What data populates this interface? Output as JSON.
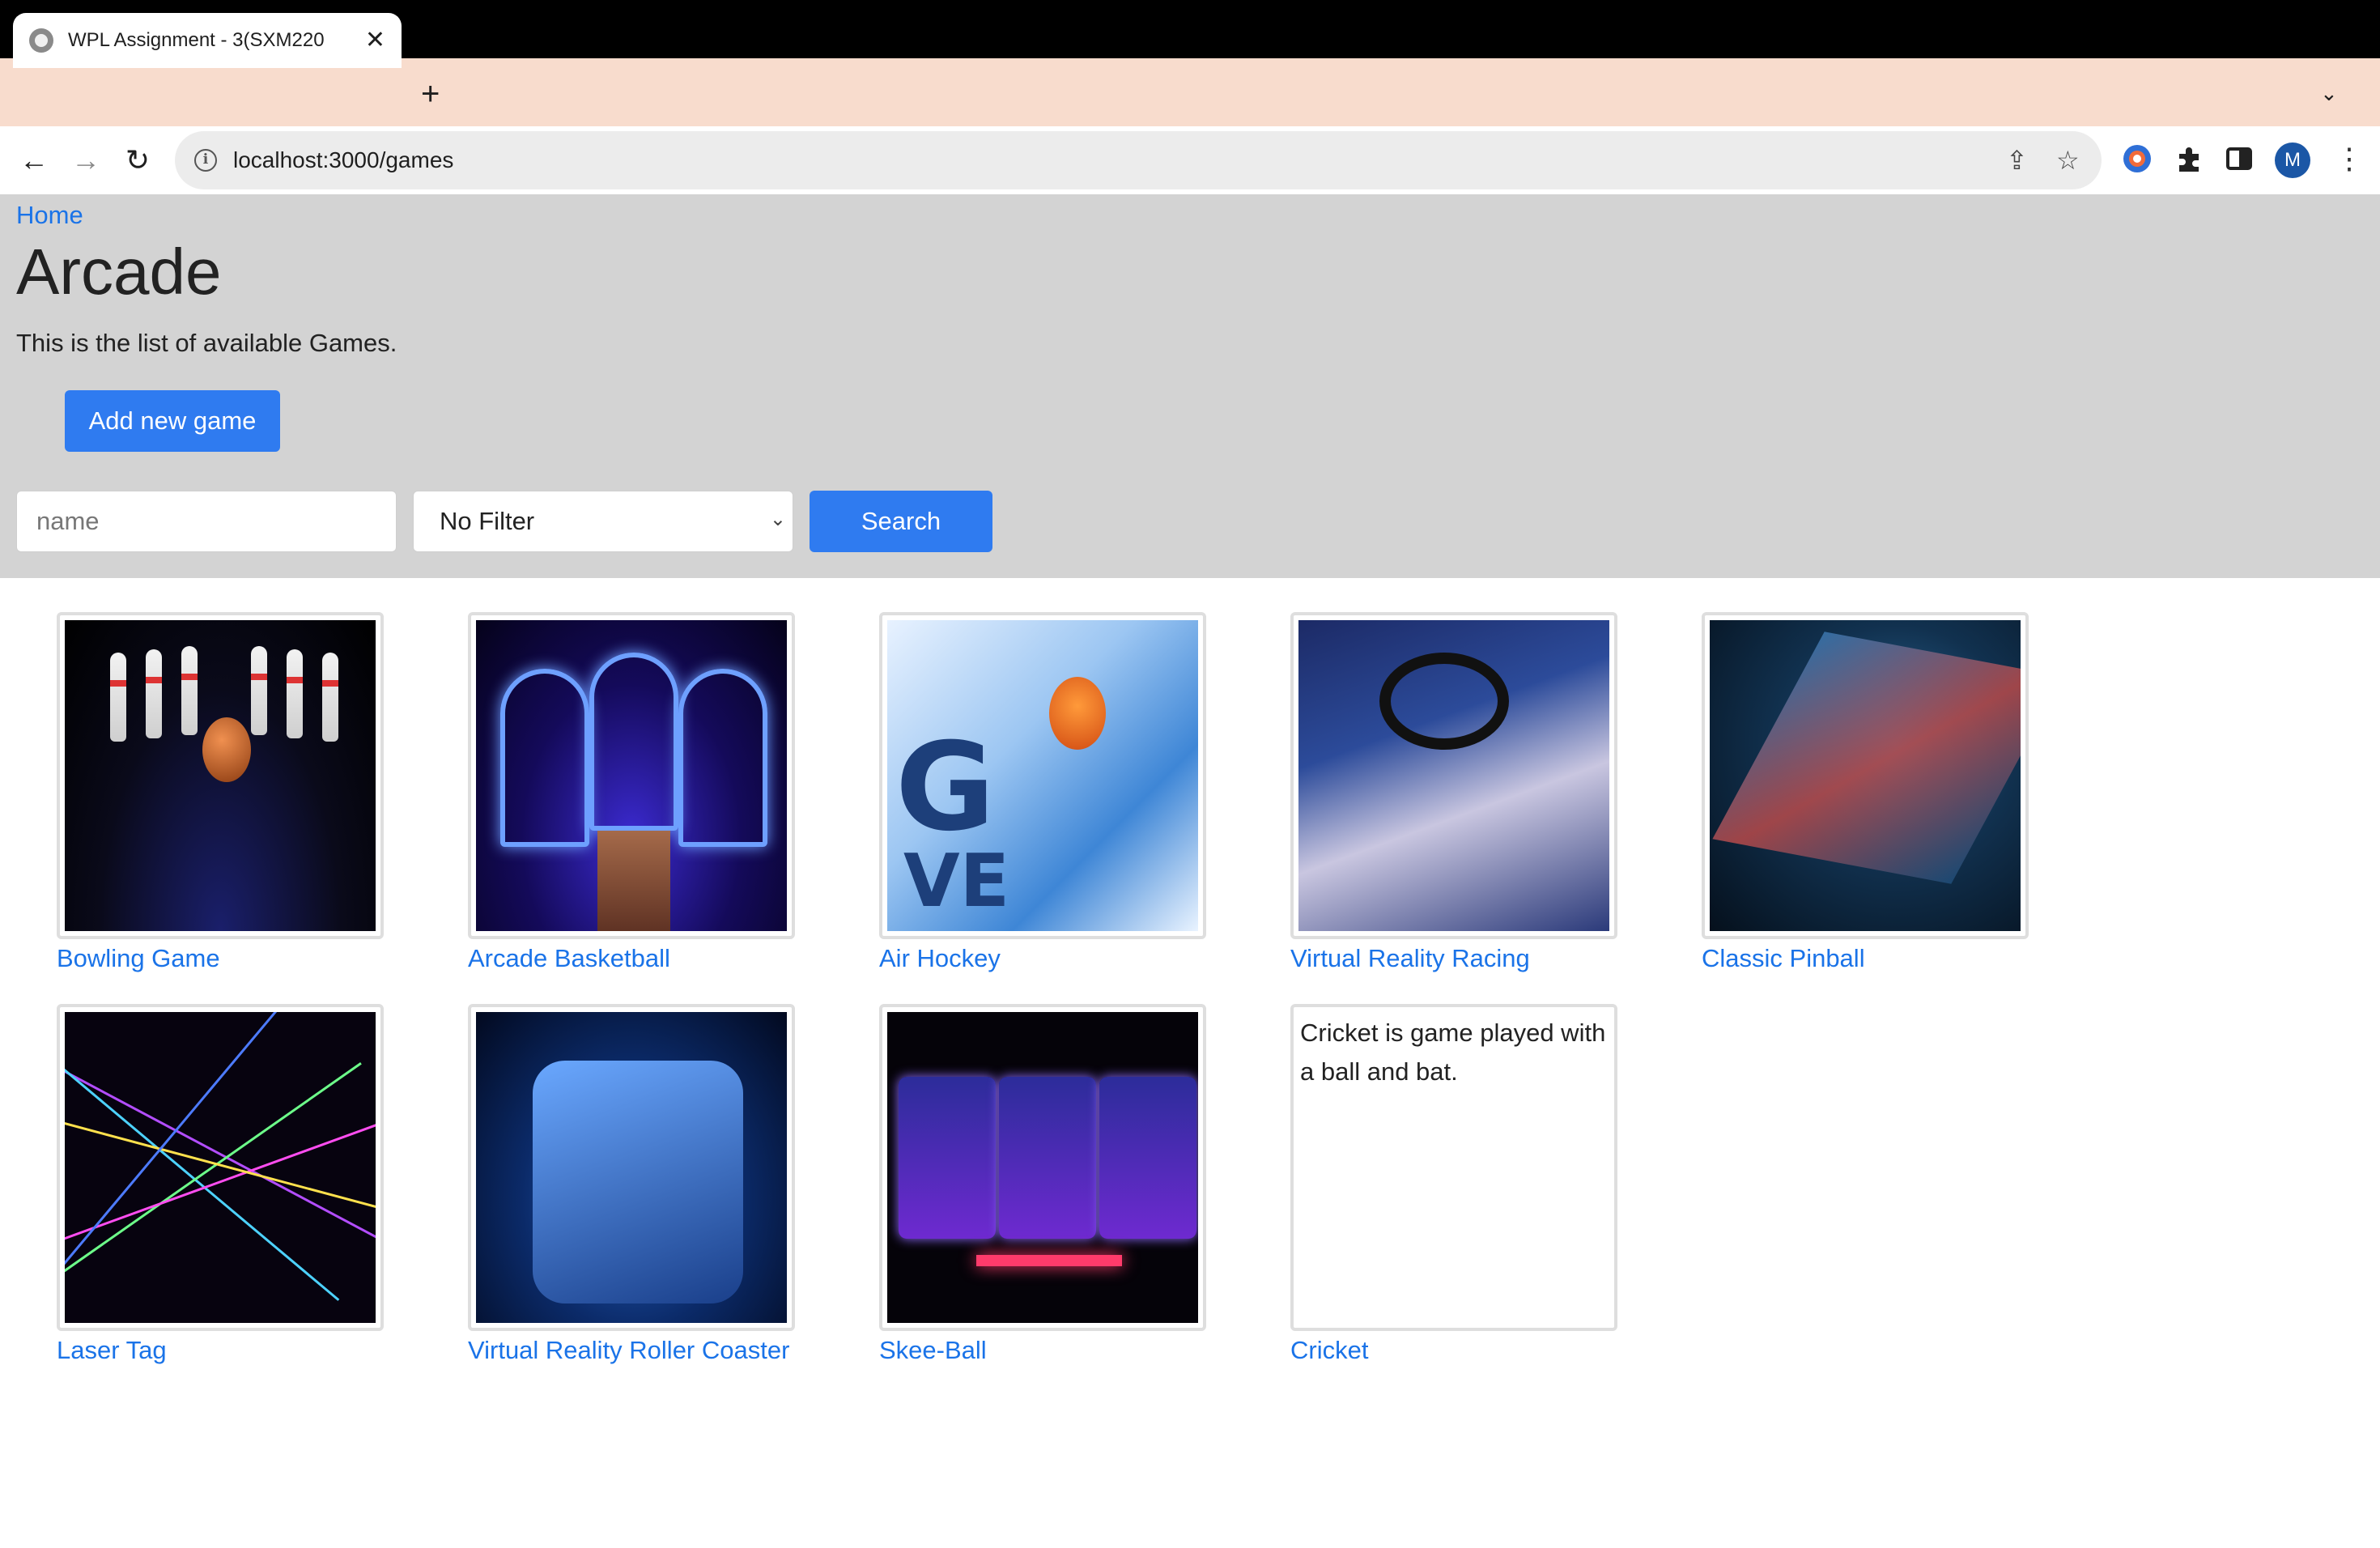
{
  "browser": {
    "tab_title": "WPL Assignment - 3(SXM220",
    "url": "localhost:3000/games"
  },
  "page": {
    "home_link": "Home",
    "title": "Arcade",
    "description": "This is the list of available Games.",
    "add_button": "Add new game",
    "search_placeholder": "name",
    "filter_selected": "No Filter",
    "search_button": "Search"
  },
  "games": [
    {
      "name": "Bowling Game"
    },
    {
      "name": "Arcade Basketball"
    },
    {
      "name": "Air Hockey"
    },
    {
      "name": "Virtual Reality Racing"
    },
    {
      "name": "Classic Pinball"
    },
    {
      "name": "Laser Tag"
    },
    {
      "name": "Virtual Reality Roller Coaster"
    },
    {
      "name": "Skee-Ball"
    },
    {
      "name": "Cricket",
      "image_alt": "Cricket is game played with a ball and bat."
    }
  ],
  "colors": {
    "link": "#1a73e8",
    "primary_button": "#2f7bf0",
    "header_bg": "#d3d3d3",
    "tab_strip": "#f8dccd"
  },
  "icons": {
    "profile_initial": "M"
  }
}
